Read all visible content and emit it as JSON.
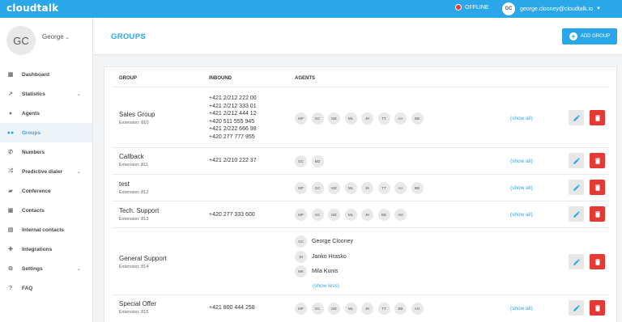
{
  "topbar": {
    "logo": "cloudtalk",
    "status": "OFFLINE",
    "user_initials": "GC",
    "user_email": "george.clooney@cloudtalk.io"
  },
  "sidebar": {
    "avatar_initials": "GC",
    "user_name": "George",
    "items": [
      {
        "label": "Dashboard",
        "icon": "dashboard-icon"
      },
      {
        "label": "Statistics",
        "icon": "chart-icon",
        "chevron": true
      },
      {
        "label": "Agents",
        "icon": "person-icon"
      },
      {
        "label": "Groups",
        "icon": "group-icon",
        "active": true
      },
      {
        "label": "Numbers",
        "icon": "phone-icon"
      },
      {
        "label": "Predictive dialer",
        "icon": "shuffle-icon",
        "chevron": true
      },
      {
        "label": "Conference",
        "icon": "chat-icon"
      },
      {
        "label": "Contacts",
        "icon": "contact-icon"
      },
      {
        "label": "Internal contacts",
        "icon": "internal-contacts-icon"
      },
      {
        "label": "Integrations",
        "icon": "puzzle-icon"
      },
      {
        "label": "Settings",
        "icon": "gear-icon",
        "chevron": true
      },
      {
        "label": "FAQ",
        "icon": "help-icon"
      }
    ]
  },
  "header": {
    "title": "GROUPS",
    "add_label": "ADD GROUP"
  },
  "table": {
    "headers": {
      "group": "GROUP",
      "inbound": "INBOUND",
      "agents": "AGENTS"
    },
    "show_all": "(show all)",
    "show_less": "(show less)",
    "rows": [
      {
        "name": "Sales Group",
        "extension": "Extension: 810",
        "inbound": [
          "+421 2/212 222 00",
          "+421 2/212 333 01",
          "+421 2/212 444 12",
          "+420 511 555 945",
          "+421 2/222 666 98",
          "+420 277 777 955"
        ],
        "agents": [
          "MP",
          "GC",
          "MZ",
          "ML",
          "JH",
          "TT",
          "AA",
          "BB"
        ]
      },
      {
        "name": "Callback",
        "extension": "Extension: 811",
        "inbound": [
          "+421 2/210 222 37"
        ],
        "agents": [
          "GC",
          "MZ"
        ]
      },
      {
        "name": "test",
        "extension": "Extension: 812",
        "inbound": [],
        "agents": [
          "MP",
          "GC",
          "MZ",
          "ML",
          "JH",
          "TT",
          "AA",
          "BB"
        ]
      },
      {
        "name": "Tech. Support",
        "extension": "Extension: 813",
        "inbound": [
          "+420 277 333 600"
        ],
        "agents": [
          "MP",
          "GC",
          "MZ",
          "ML",
          "JH",
          "BB",
          "AO"
        ]
      },
      {
        "name": "General Support",
        "extension": "Extension: 814",
        "inbound": [],
        "expanded_agents": [
          {
            "initials": "GC",
            "name": "George Clooney"
          },
          {
            "initials": "JH",
            "name": "Janko Hrasko"
          },
          {
            "initials": "MK",
            "name": "Mila Kunis"
          }
        ]
      },
      {
        "name": "Special Offer",
        "extension": "Extension: 815",
        "inbound": [
          "+421 800 444 258"
        ],
        "agents": [
          "MP",
          "GC",
          "MZ",
          "ML",
          "JH",
          "TT",
          "BB",
          "AO"
        ]
      }
    ]
  },
  "colors": {
    "accent": "#2aa7e8",
    "danger": "#e53935",
    "offline": "#e53935"
  }
}
